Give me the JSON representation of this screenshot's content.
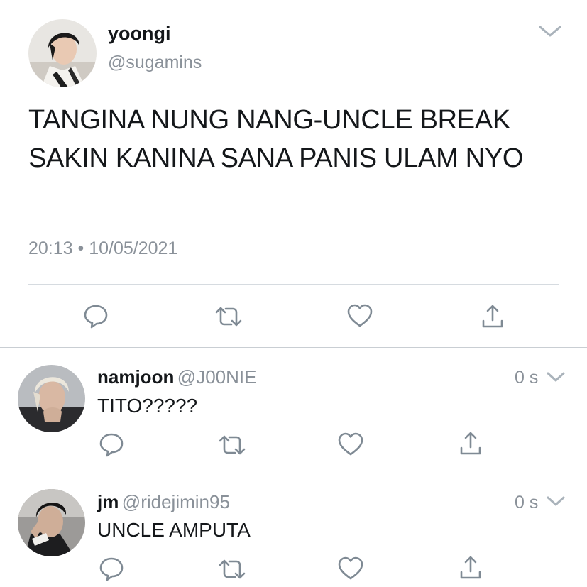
{
  "main_tweet": {
    "name": "yoongi",
    "handle": "@sugamins",
    "text": "TANGINA NUNG NANG-UNCLE BREAK SAKIN KANINA SANA PANIS ULAM NYO",
    "timestamp": "20:13 • 10/05/2021",
    "avatar": "avatar-photo",
    "menu_icon": "chevron-down-icon",
    "actions": [
      "reply-icon",
      "retweet-icon",
      "like-icon",
      "share-icon"
    ]
  },
  "replies": [
    {
      "name": "namjoon",
      "handle": "@J00NIE",
      "text": "TITO?????",
      "time": "0 s",
      "avatar": "avatar-photo",
      "menu_icon": "chevron-down-icon"
    },
    {
      "name": "jm",
      "handle": "@ridejimin95",
      "text": "UNCLE AMPUTA",
      "time": "0 s",
      "avatar": "avatar-photo",
      "menu_icon": "chevron-down-icon"
    }
  ],
  "colors": {
    "text": "#14171a",
    "secondary_text": "#8a9199",
    "divider": "#d6dbe0",
    "icon": "#7f8a94"
  }
}
